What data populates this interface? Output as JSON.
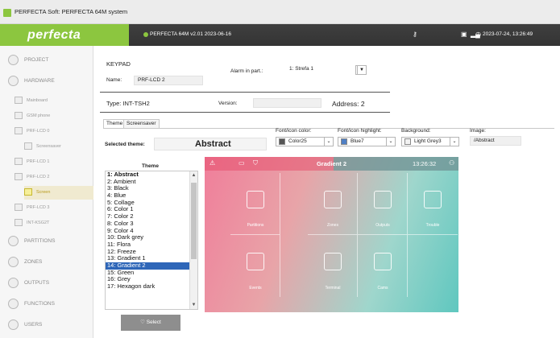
{
  "window": {
    "title": "PERFECTA Soft: PERFECTA 64M system"
  },
  "topbar": {
    "logo": "perfecta",
    "system": "PERFECTA 64M v2.01 2023-06-16",
    "datetime": "2023-07-24, 13:26:49"
  },
  "sidebar": {
    "project": "PROJECT",
    "hardware": "HARDWARE",
    "sub": [
      "Mainboard",
      "GSM phone",
      "PRF-LCD 0",
      "Screensaver",
      "PRF-LCD 1",
      "PRF-LCD 2",
      "Screen",
      "PRF-LCD 3",
      "INT-KSG2T"
    ],
    "partitions": "PARTITIONS",
    "zones": "ZONES",
    "outputs": "OUTPUTS",
    "functions": "FUNCTIONS",
    "users": "USERS"
  },
  "keypad": {
    "heading": "KEYPAD",
    "name_label": "Name:",
    "name_value": "PRF-LCD 2",
    "alarm_label": "Alarm in part.:",
    "alarm_value": "1: Strefa 1",
    "type_label": "Type: INT-TSH2",
    "version_label": "Version:",
    "address_label": "Address: 2"
  },
  "tabs": [
    "Theme",
    "Screensaver"
  ],
  "theme": {
    "selected_label": "Selected theme:",
    "selected_value": "Abstract",
    "font_color_label": "Font/icon color:",
    "font_color_value": "Color25",
    "font_color_hex": "#555555",
    "highlight_label": "Font/icon highlight:",
    "highlight_value": "Blue7",
    "highlight_hex": "#4f7fc4",
    "background_label": "Background:",
    "background_value": "Light Grey3",
    "background_hex": "#f2f2f2",
    "image_label": "Image:",
    "image_value": "/Abstract",
    "list_heading": "Theme",
    "list": [
      "1: Abstract",
      "2: Ambient",
      "3: Black",
      "4: Blue",
      "5: Collage",
      "6: Color 1",
      "7: Color 2",
      "8: Color 3",
      "9: Color 4",
      "10: Dark grey",
      "11: Flora",
      "12: Freeze",
      "13: Gradient 1",
      "14: Gradient 2",
      "15: Green",
      "16: Grey",
      "17: Hexagon dark"
    ],
    "select_button": "Select"
  },
  "preview": {
    "title": "Gradient 2",
    "time": "13:26:32",
    "tiles": [
      "Partitions",
      "Zones",
      "Outputs",
      "Trouble",
      "Events",
      "Terminal",
      "Cams"
    ]
  }
}
